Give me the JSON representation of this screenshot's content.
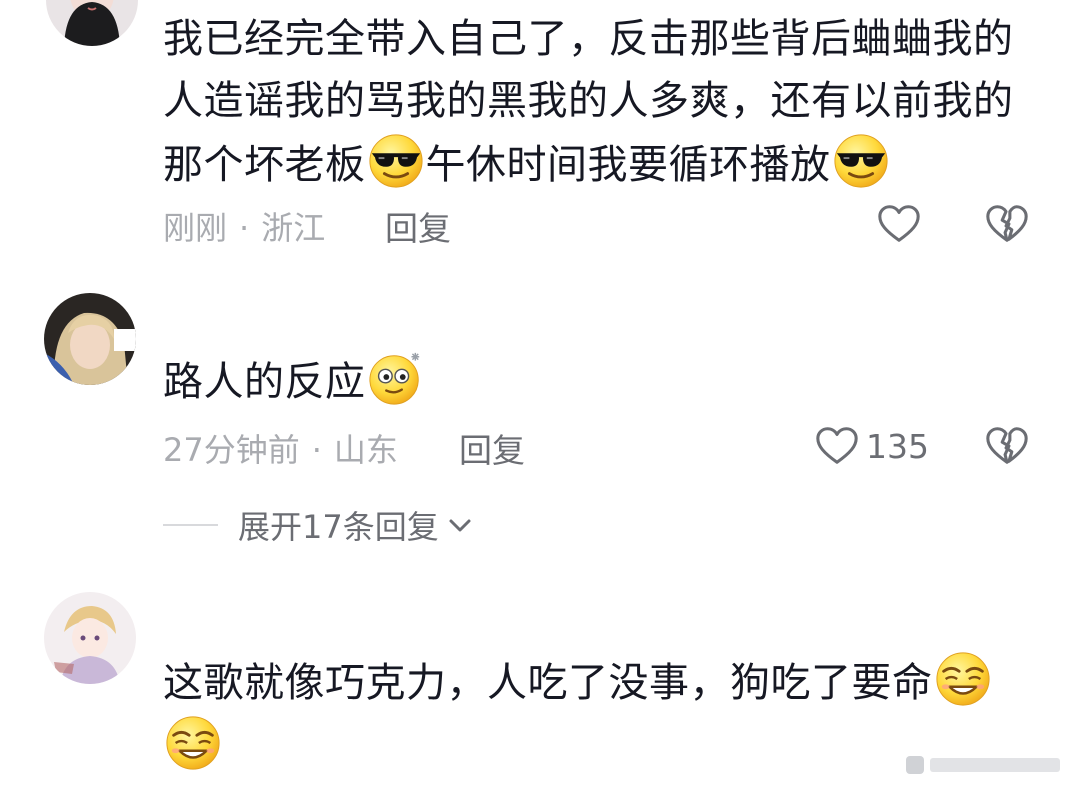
{
  "comments": [
    {
      "text_segments": [
        "我已经完全带入自己了，反击那些背后蛐蛐我的人造谣我的骂我的黑我的人多爽，还有以前我的那个坏老板",
        "午休时间我要循环播放"
      ],
      "emojis": [
        "sunglasses-emoji",
        "sunglasses-emoji"
      ],
      "time": "刚刚",
      "separator": "·",
      "location": "浙江",
      "reply_label": "回复",
      "like_count": "",
      "avatar": "avatar-woman-icon"
    },
    {
      "text_segments": [
        "路人的反应"
      ],
      "emojis": [
        "dizzy-eyes-emoji"
      ],
      "time": "27分钟前",
      "separator": "·",
      "location": "山东",
      "reply_label": "回复",
      "like_count": "135",
      "avatar": "avatar-blonde-icon"
    },
    {
      "text_segments": [
        "这歌就像巧克力，人吃了没事，狗吃了要命"
      ],
      "emojis": [
        "sly-grin-emoji",
        "sly-grin-emoji"
      ],
      "avatar": "avatar-anime-icon"
    }
  ],
  "expand_replies": {
    "label": "展开17条回复",
    "icon": "chevron-down-icon"
  },
  "icons": {
    "like": "heart-outline-icon",
    "dislike": "broken-heart-icon"
  },
  "colors": {
    "text_primary": "#161823",
    "text_secondary": "#a9abb0",
    "action_text": "#6b6d73",
    "background": "#ffffff"
  }
}
